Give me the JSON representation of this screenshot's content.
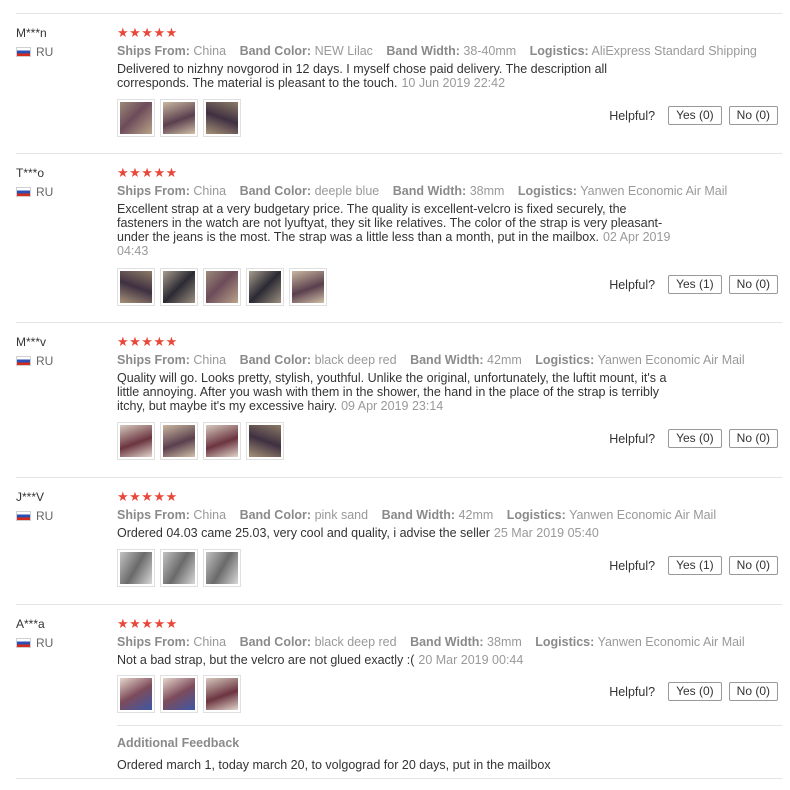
{
  "labels": {
    "ships_from": "Ships From:",
    "band_color": "Band Color:",
    "band_width": "Band Width:",
    "logistics": "Logistics:",
    "helpful": "Helpful?",
    "stars": "★★★★★"
  },
  "reviews": [
    {
      "user": "M***n",
      "country": "RU",
      "rating": 5,
      "ships_from": "China",
      "band_color": "NEW Lilac",
      "band_width": "38-40mm",
      "logistics": "AliExpress Standard Shipping",
      "text": "Delivered to nizhny novgorod in 12 days. I myself chose paid delivery. The description all corresponds. The material is pleasant to the touch.",
      "date": "10 Jun 2019 22:42",
      "yes": "Yes (0)",
      "no": "No (0)",
      "photo_count": 3
    },
    {
      "user": "T***o",
      "country": "RU",
      "rating": 5,
      "ships_from": "China",
      "band_color": "deeple blue",
      "band_width": "38mm",
      "logistics": "Yanwen Economic Air Mail",
      "text": "Excellent strap at a very budgetary price. The quality is excellent-velcro is fixed securely, the fasteners in the watch are not lyuftyat, they sit like relatives. The color of the strap is very pleasant-under the jeans is the most. The strap was a little less than a month, put in the mailbox.",
      "date": "02 Apr 2019 04:43",
      "yes": "Yes (1)",
      "no": "No (0)",
      "photo_count": 5
    },
    {
      "user": "M***v",
      "country": "RU",
      "rating": 5,
      "ships_from": "China",
      "band_color": "black deep red",
      "band_width": "42mm",
      "logistics": "Yanwen Economic Air Mail",
      "text": "Quality will go. Looks pretty, stylish, youthful. Unlike the original, unfortunately, the luftit mount, it's a little annoying. After you wash with them in the shower, the hand in the place of the strap is terribly itchy, but maybe it's my excessive hairy.",
      "date": "09 Apr 2019 23:14",
      "yes": "Yes (0)",
      "no": "No (0)",
      "photo_count": 4
    },
    {
      "user": "J***V",
      "country": "RU",
      "rating": 5,
      "ships_from": "China",
      "band_color": "pink sand",
      "band_width": "42mm",
      "logistics": "Yanwen Economic Air Mail",
      "text": "Ordered 04.03 came 25.03, very cool and quality, i advise the seller",
      "date": "25 Mar 2019 05:40",
      "yes": "Yes (1)",
      "no": "No (0)",
      "photo_count": 3
    },
    {
      "user": "A***a",
      "country": "RU",
      "rating": 5,
      "ships_from": "China",
      "band_color": "black deep red",
      "band_width": "38mm",
      "logistics": "Yanwen Economic Air Mail",
      "text": "Not a bad strap, but the velcro are not glued exactly :(",
      "date": "20 Mar 2019 00:44",
      "yes": "Yes (0)",
      "no": "No (0)",
      "photo_count": 3,
      "additional_feedback_title": "Additional Feedback",
      "additional_feedback_text": "Ordered march 1, today march 20, to volgograd for 20 days, put in the mailbox"
    }
  ]
}
